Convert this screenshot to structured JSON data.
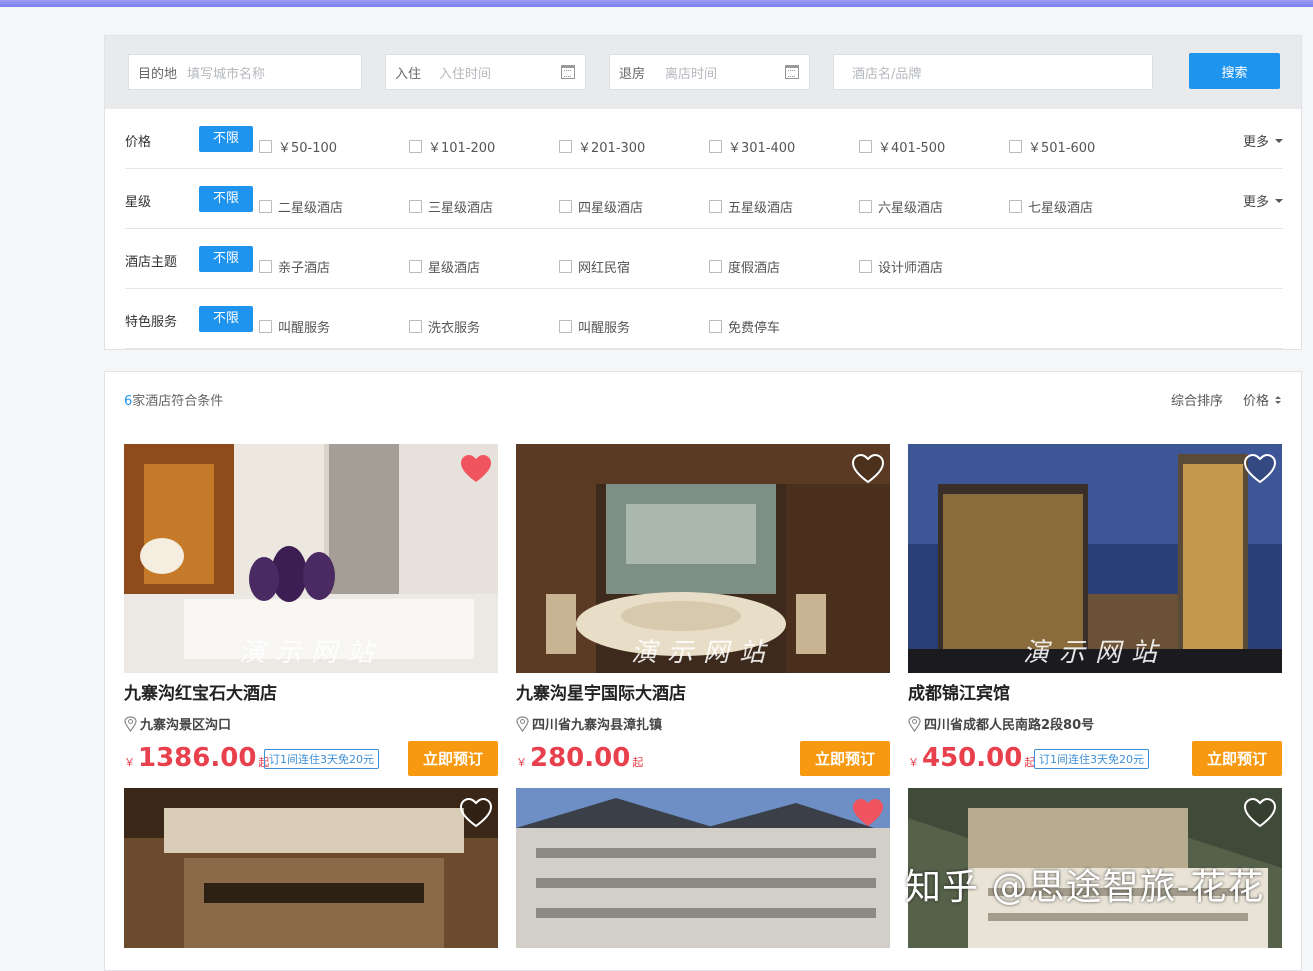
{
  "search": {
    "dest_label": "目的地",
    "dest_placeholder": "填写城市名称",
    "checkin_label": "入住",
    "checkin_placeholder": "入住时间",
    "checkout_label": "退房",
    "checkout_placeholder": "离店时间",
    "hotel_placeholder": "酒店名/品牌",
    "button": "搜索"
  },
  "filters": [
    {
      "title": "价格",
      "unlimited": "不限",
      "options": [
        "￥50-100",
        "￥101-200",
        "￥201-300",
        "￥301-400",
        "￥401-500",
        "￥501-600"
      ],
      "more": "更多"
    },
    {
      "title": "星级",
      "unlimited": "不限",
      "options": [
        "二星级酒店",
        "三星级酒店",
        "四星级酒店",
        "五星级酒店",
        "六星级酒店",
        "七星级酒店"
      ],
      "more": "更多"
    },
    {
      "title": "酒店主题",
      "unlimited": "不限",
      "options": [
        "亲子酒店",
        "星级酒店",
        "网红民宿",
        "度假酒店",
        "设计师酒店"
      ],
      "more": ""
    },
    {
      "title": "特色服务",
      "unlimited": "不限",
      "options": [
        "叫醒服务",
        "洗衣服务",
        "叫醒服务",
        "免费停车"
      ],
      "more": ""
    }
  ],
  "results": {
    "count": "6",
    "count_suffix": "家酒店符合条件",
    "sort_default": "综合排序",
    "sort_price": "价格"
  },
  "hotels": [
    {
      "name": "九寨沟红宝石大酒店",
      "address": "九寨沟景区沟口",
      "currency": "￥",
      "price": "1386.00",
      "price_suffix": "起",
      "promo": "订1间连住3天免20元",
      "book": "立即预订",
      "watermark": "演示网站",
      "favorited": true
    },
    {
      "name": "九寨沟星宇国际大酒店",
      "address": "四川省九寨沟县漳扎镇",
      "currency": "￥",
      "price": "280.00",
      "price_suffix": "起",
      "promo": "",
      "book": "立即预订",
      "watermark": "演示网站",
      "favorited": false
    },
    {
      "name": "成都锦江宾馆",
      "address": "四川省成都人民南路2段80号",
      "currency": "￥",
      "price": "450.00",
      "price_suffix": "起",
      "promo": "订1间连住3天免20元",
      "book": "立即预订",
      "watermark": "演示网站",
      "favorited": false
    },
    {
      "favorited": false
    },
    {
      "favorited": true
    },
    {
      "favorited": false
    }
  ],
  "overlay_watermark": "知乎 @思途智旅-花花",
  "colors": {
    "accent": "#1f94ef",
    "price": "#e8404c",
    "book": "#f79a12",
    "heart_active": "#f0545f"
  }
}
